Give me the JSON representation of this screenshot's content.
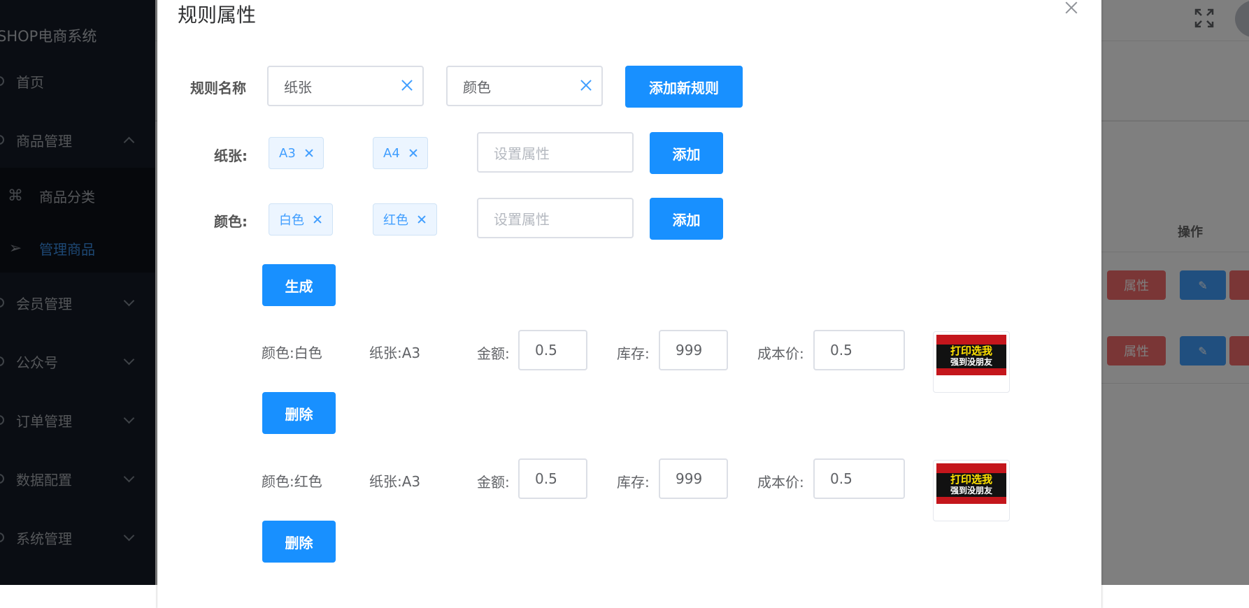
{
  "app": {
    "brand": "SHOP电商系统",
    "menu": [
      {
        "label": "首页"
      },
      {
        "label": "商品管理"
      },
      {
        "label": "会员管理"
      },
      {
        "label": "公众号"
      },
      {
        "label": "订单管理"
      },
      {
        "label": "数据配置"
      },
      {
        "label": "系统管理"
      }
    ],
    "submenu": [
      {
        "label": "商品分类"
      },
      {
        "label": "管理商品"
      }
    ],
    "table": {
      "op_header": "操作",
      "attr_button": "属性"
    }
  },
  "dialog": {
    "title": "规则属性",
    "rule_name_label": "规则名称",
    "rule_inputs": [
      "纸张",
      "颜色"
    ],
    "add_rule_button": "添加新规则",
    "attributes": [
      {
        "label": "纸张:",
        "tags": [
          "A3",
          "A4"
        ],
        "placeholder": "设置属性",
        "add_button": "添加"
      },
      {
        "label": "颜色:",
        "tags": [
          "白色",
          "红色"
        ],
        "placeholder": "设置属性",
        "add_button": "添加"
      }
    ],
    "generate_button": "生成",
    "skus": [
      {
        "color": "颜色:白色",
        "paper": "纸张:A3",
        "amount_label": "金额:",
        "amount": "0.5",
        "stock_label": "库存:",
        "stock": "999",
        "cost_label": "成本价:",
        "cost": "0.5",
        "delete_button": "删除"
      },
      {
        "color": "颜色:红色",
        "paper": "纸张:A3",
        "amount_label": "金额:",
        "amount": "0.5",
        "stock_label": "库存:",
        "stock": "999",
        "cost_label": "成本价:",
        "cost": "0.5",
        "delete_button": "删除"
      }
    ],
    "thumb_text": {
      "line1": "打印选我",
      "line2": "强到没朋友"
    }
  },
  "colors": {
    "primary": "#1890ff",
    "danger": "#f56c6c",
    "sidebar": "#151b26"
  }
}
